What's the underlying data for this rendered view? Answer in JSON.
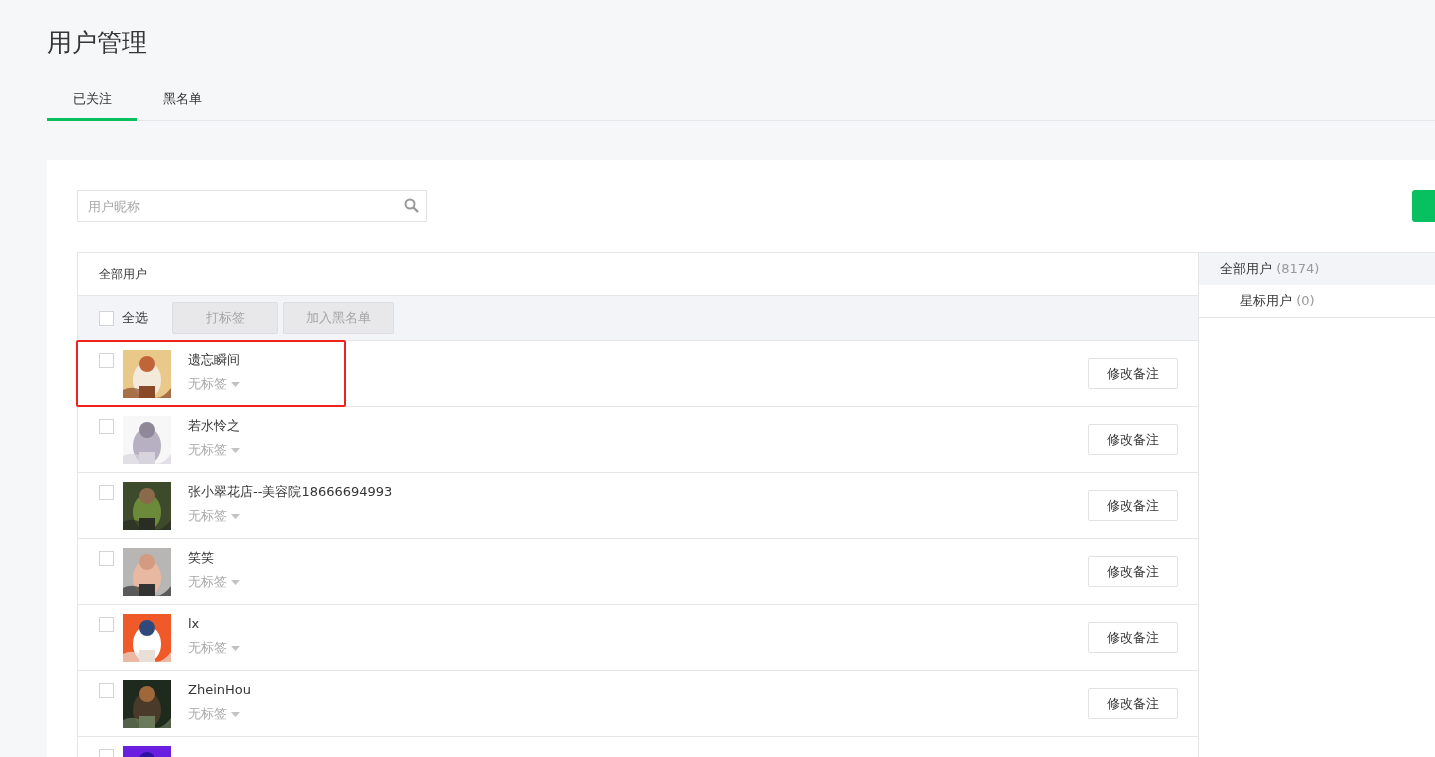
{
  "page_title": "用户管理",
  "tabs": [
    {
      "label": "已关注",
      "selected": true
    },
    {
      "label": "黑名单",
      "selected": false
    }
  ],
  "search": {
    "placeholder": "用户昵称"
  },
  "table": {
    "heading": "全部用户",
    "select_all": {
      "label": "全选",
      "checked": false
    },
    "actions": [
      {
        "label": "打标签",
        "disabled": true
      },
      {
        "label": "加入黑名单",
        "disabled": true
      }
    ],
    "rows": [
      {
        "name": "遗忘瞬间",
        "tag": "无标签",
        "checked": false,
        "highlighted": true,
        "button": "修改备注"
      },
      {
        "name": "若水怜之",
        "tag": "无标签",
        "checked": false,
        "highlighted": false,
        "button": "修改备注"
      },
      {
        "name": "张小翠花店--美容院18666694993",
        "tag": "无标签",
        "checked": false,
        "highlighted": false,
        "button": "修改备注"
      },
      {
        "name": "笑笑",
        "tag": "无标签",
        "checked": false,
        "highlighted": false,
        "button": "修改备注"
      },
      {
        "name": "lx",
        "tag": "无标签",
        "checked": false,
        "highlighted": false,
        "button": "修改备注"
      },
      {
        "name": "ZheinHou",
        "tag": "无标签",
        "checked": false,
        "highlighted": false,
        "button": "修改备注"
      },
      {
        "checked": false,
        "highlighted": false
      }
    ]
  },
  "groups": [
    {
      "label": "全部用户",
      "count": "(8174)",
      "selected": true,
      "children": [
        {
          "label": "星标用户",
          "count": "(0)",
          "selected": false
        }
      ]
    }
  ]
}
